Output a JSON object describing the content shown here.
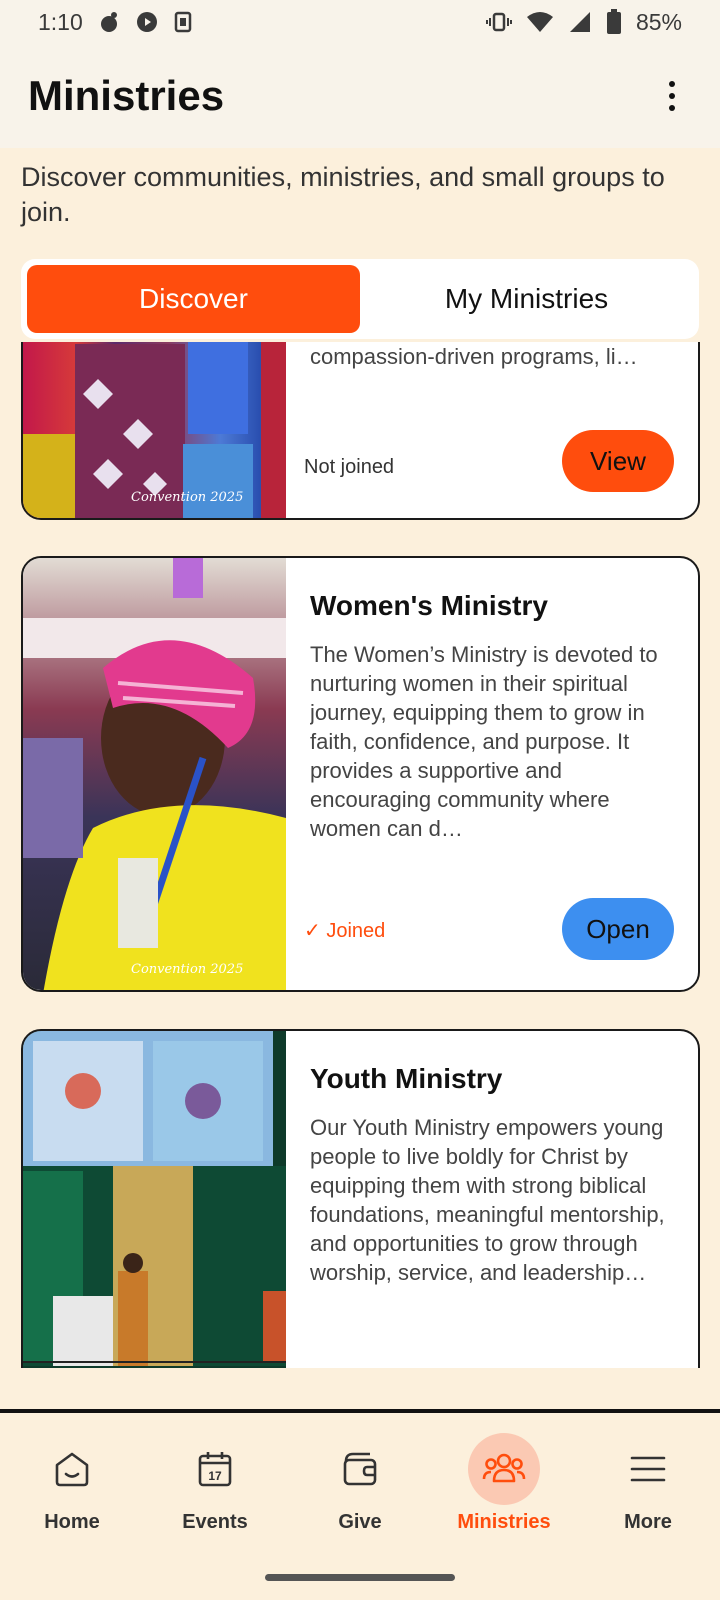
{
  "status_bar": {
    "time": "1:10",
    "battery": "85%"
  },
  "app_bar": {
    "title": "Ministries"
  },
  "intro": {
    "text": "Discover communities, ministries, and small groups to join."
  },
  "tabs": [
    {
      "label": "Discover",
      "active": true
    },
    {
      "label": "My Ministries",
      "active": false
    }
  ],
  "cards": [
    {
      "title": "",
      "description": "compassion-driven programs, li…",
      "status": "Not joined",
      "button": "View",
      "image_logo": "Convention 2025"
    },
    {
      "title": "Women's Ministry",
      "description": "The Women’s Ministry is devoted to nurturing women in their spiritual journey, equipping them to grow in faith, confidence, and purpose. It provides a supportive and encouraging community where women can d…",
      "status": "✓ Joined",
      "button": "Open",
      "image_logo": "Convention 2025"
    },
    {
      "title": "Youth Ministry",
      "description": "Our Youth Ministry empowers young people to live boldly for Christ by equipping them with strong biblical foundations, meaningful mentorship, and opportunities to grow through worship, service, and leadership…"
    }
  ],
  "bottom_nav": [
    {
      "label": "Home",
      "icon": "home-icon"
    },
    {
      "label": "Events",
      "icon": "calendar-icon",
      "badge": "17"
    },
    {
      "label": "Give",
      "icon": "wallet-icon"
    },
    {
      "label": "Ministries",
      "icon": "people-icon",
      "active": true
    },
    {
      "label": "More",
      "icon": "menu-icon"
    }
  ],
  "colors": {
    "accent": "#ff4d0d",
    "open_button": "#3d8ff0",
    "background": "#fcf0dc"
  }
}
